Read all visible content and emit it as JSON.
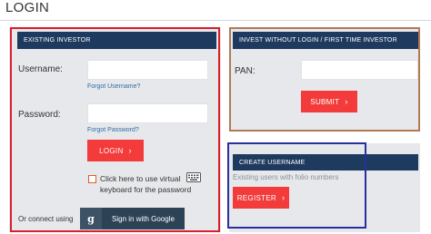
{
  "page": {
    "title": "LOGIN"
  },
  "existing_investor": {
    "header": "EXISTING INVESTOR",
    "username_label": "Username:",
    "username_value": "",
    "forgot_username": "Forgot Username?",
    "password_label": "Password:",
    "password_value": "",
    "forgot_password": "Forgot Password?",
    "login_button": "LOGIN",
    "virtual_keyboard_text": "Click here to use virtual keyboard for the password",
    "virtual_keyboard_checked": false,
    "keyboard_icon": "keyboard-icon",
    "or_connect": "Or connect using",
    "google_glyph": "g",
    "google_button": "Sign in with Google"
  },
  "invest_without_login": {
    "header": "INVEST WITHOUT LOGIN / FIRST TIME INVESTOR",
    "pan_label": "PAN:",
    "pan_value": "",
    "submit_button": "SUBMIT"
  },
  "create_username": {
    "header": "CREATE USERNAME",
    "description": "Existing users with folio numbers",
    "register_button": "REGISTER"
  },
  "colors": {
    "header_bg": "#1e3a5f",
    "panel_bg": "#e6e8eb",
    "button_red": "#f43b3b",
    "outline_red": "#d8202a",
    "outline_brown": "#b07a55",
    "outline_blue": "#2a2f9e",
    "link": "#2f6ea8"
  }
}
